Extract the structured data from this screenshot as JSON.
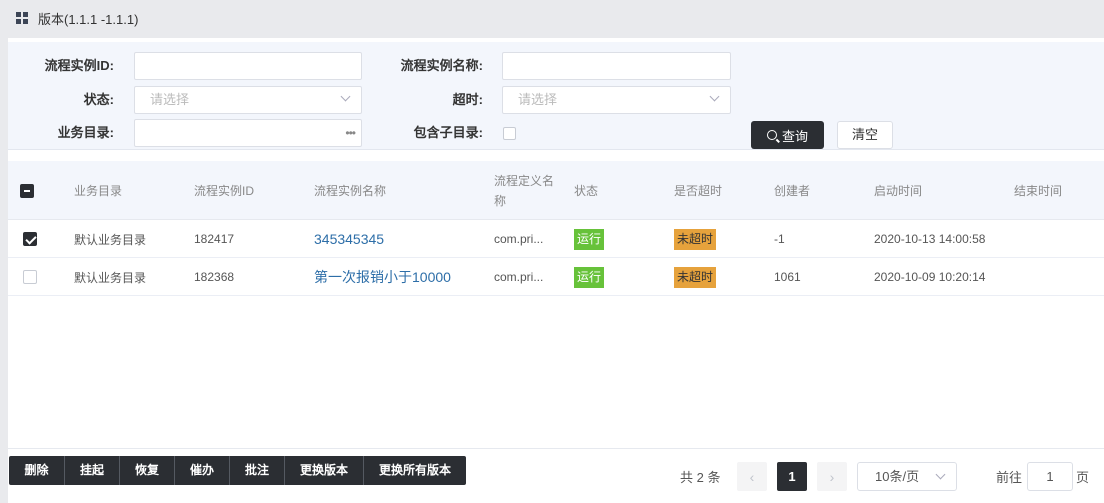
{
  "window": {
    "title": "版本(1.1.1 -1.1.1)",
    "icon": "grid-icon"
  },
  "filter": {
    "instance_id_label": "流程实例ID:",
    "instance_id_value": "",
    "instance_name_label": "流程实例名称:",
    "instance_name_value": "",
    "status_label": "状态:",
    "status_placeholder": "请选择",
    "timeout_label": "超时:",
    "timeout_placeholder": "请选择",
    "catalog_label": "业务目录:",
    "catalog_value": "",
    "catalog_dots": "•••",
    "include_sub_label": "包含子目录:",
    "query_label": "查询",
    "clear_label": "清空"
  },
  "table": {
    "columns": [
      "业务目录",
      "流程实例ID",
      "流程实例名称",
      "流程定义名称",
      "状态",
      "是否超时",
      "创建者",
      "启动时间",
      "结束时间"
    ],
    "rows": [
      {
        "checked": true,
        "catalog": "默认业务目录",
        "id": "182417",
        "name": "345345345",
        "def": "com.pri...",
        "status": "运行",
        "timeout": "未超时",
        "creator": "-1",
        "start": "2020-10-13 14:00:58",
        "end": ""
      },
      {
        "checked": false,
        "catalog": "默认业务目录",
        "id": "182368",
        "name": "第一次报销小于10000",
        "def": "com.pri...",
        "status": "运行",
        "timeout": "未超时",
        "creator": "1061",
        "start": "2020-10-09 10:20:14",
        "end": ""
      }
    ]
  },
  "actions": {
    "delete": "删除",
    "suspend": "挂起",
    "resume": "恢复",
    "urge": "催办",
    "annotate": "批注",
    "change_version": "更换版本",
    "change_all_versions": "更换所有版本"
  },
  "pagination": {
    "total": "共 2 条",
    "current_page": "1",
    "prev": "‹",
    "next": "›",
    "page_size": "10条/页",
    "goto_label": "前往",
    "goto_value": "1",
    "page_suffix": "页"
  },
  "colors": {
    "dark": "#2b2e33",
    "running": "#67c23a",
    "not_timeout": "#e6a23c",
    "link": "#2d6ea8"
  }
}
